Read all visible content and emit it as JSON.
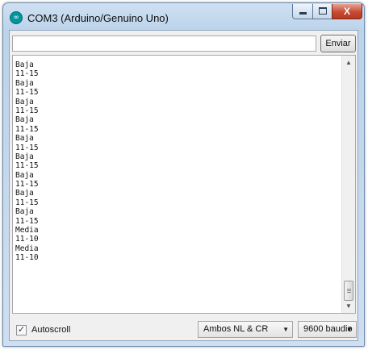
{
  "window": {
    "title": "COM3 (Arduino/Genuino Uno)",
    "icon": "arduino-logo-icon",
    "icon_glyph": "∞",
    "caption_buttons": {
      "close_glyph": "X"
    }
  },
  "send_bar": {
    "input_value": "",
    "send_label": "Enviar"
  },
  "output": {
    "lines": [
      "Baja",
      "11-15",
      "Baja",
      "11-15",
      "Baja",
      "11-15",
      "Baja",
      "11-15",
      "Baja",
      "11-15",
      "Baja",
      "11-15",
      "Baja",
      "11-15",
      "Baja",
      "11-15",
      "Baja",
      "11-15",
      "Media",
      "11-10",
      "Media",
      "11-10"
    ]
  },
  "scrollbar": {
    "up_arrow": "▲",
    "down_arrow": "▼"
  },
  "footer": {
    "autoscroll_label": "Autoscroll",
    "autoscroll_checked": true,
    "check_glyph": "✓",
    "line_ending": "Ambos NL & CR",
    "baud_rate": "9600 baudio",
    "dropdown_arrow": "▼"
  },
  "colors": {
    "title_bar": "#bcd3ea",
    "close_button": "#c74a33",
    "arduino_teal": "#00979c"
  }
}
